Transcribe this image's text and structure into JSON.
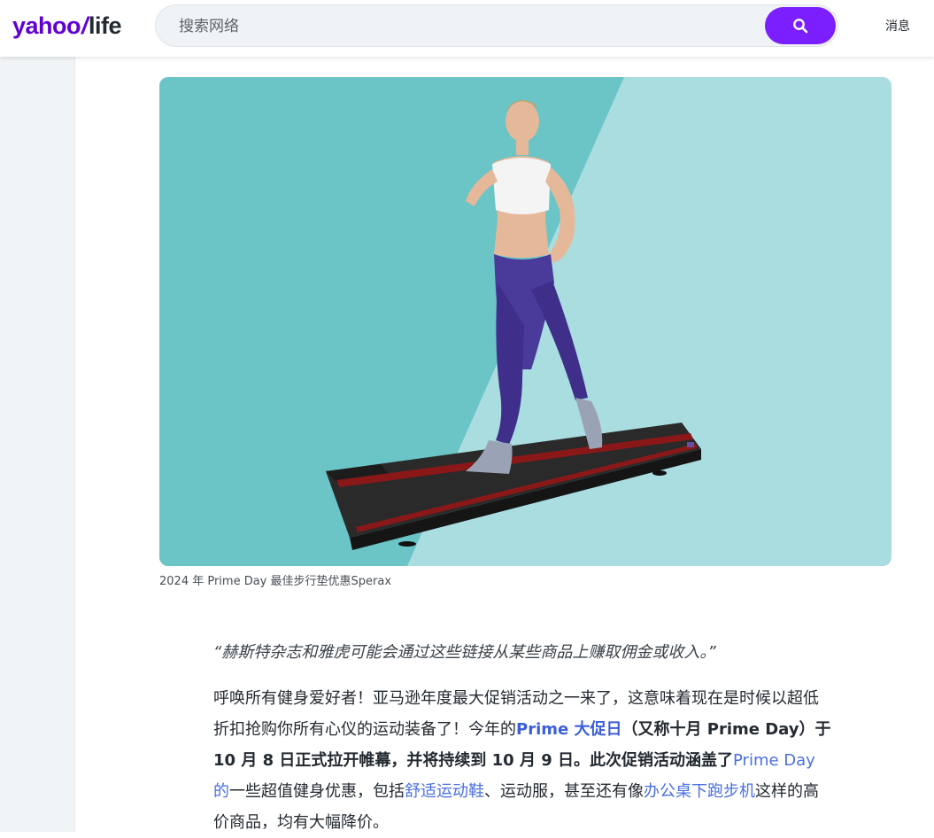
{
  "header": {
    "logo": {
      "main": "yahoo",
      "slash": "/",
      "section": "life"
    },
    "search": {
      "placeholder": "搜索网络",
      "value": ""
    },
    "search_icon": "search-icon",
    "mail_label": "消息"
  },
  "colors": {
    "brand": "#6001d2",
    "search_button": "#7b1fff",
    "link": "#4a70e0",
    "hero_dark": "#6bc4c6",
    "hero_light": "#a9dde0"
  },
  "hero": {
    "caption": "2024 年 Prime Day 最佳步行垫优惠Sperax"
  },
  "article": {
    "disclaimer": "“赫斯特杂志和雅虎可能会通过这些链接从某些商品上赚取佣金或收入。”",
    "para": {
      "t1": "呼唤所有健身爱好者！亚马逊年度最大促销活动之一来了，这意味着现在是时候以超低折扣抢购你所有心仪的运动装备了！今年的",
      "link1": "Prime 大促日",
      "b1": "（又称十月 Prime Day）于 10 月 8 日正式拉开帷幕，并将持续到 10 月 9 日。此次促销活动涵盖了",
      "link2": "Prime Day 的",
      "t2": "一些超值健身优惠，包括",
      "link3": "舒适运动鞋",
      "t3": "、运动服，甚至还有像",
      "link4": "办公桌下跑步机",
      "t4": "这样的高价商品，均有大幅降价。"
    }
  }
}
